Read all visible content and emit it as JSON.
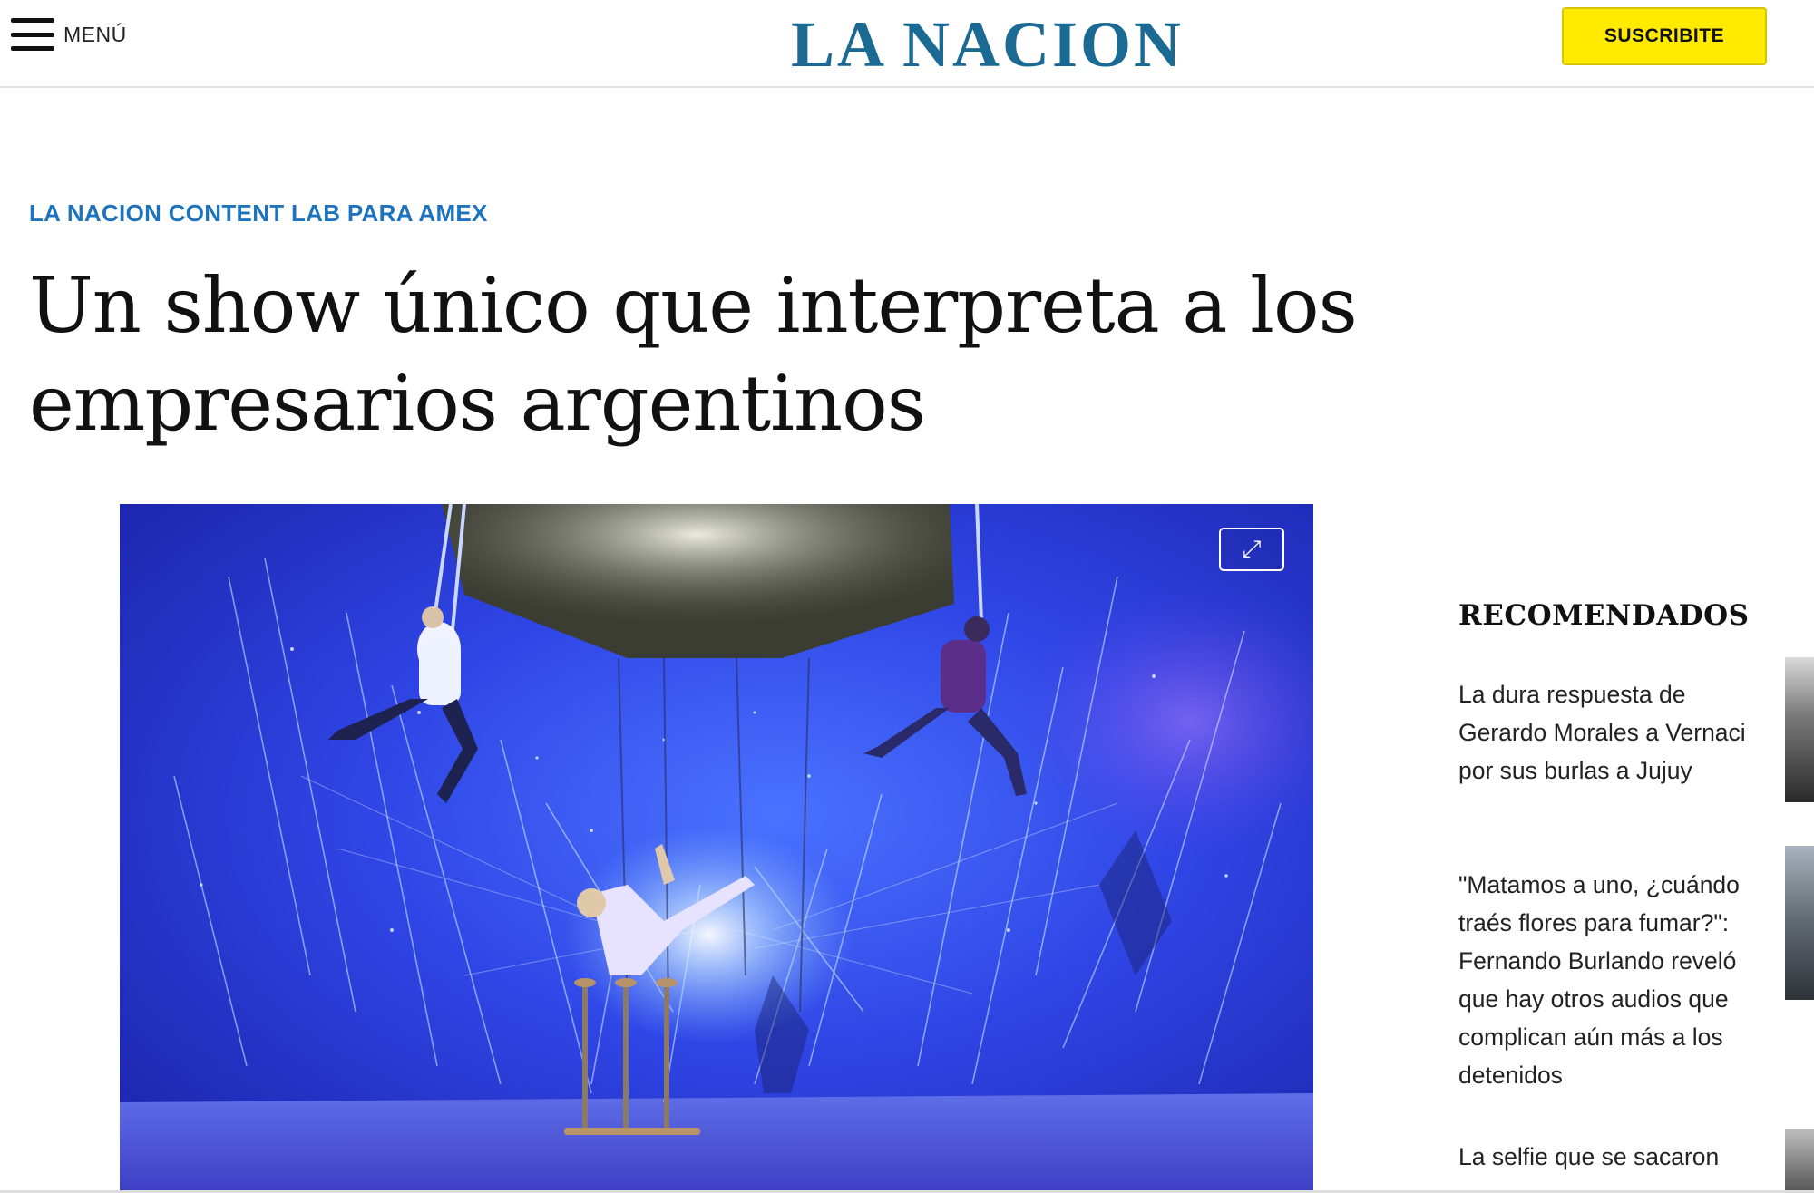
{
  "header": {
    "menu_label": "MENÚ",
    "logo_text": "LA NACION",
    "subscribe_label": "SUSCRIBITE"
  },
  "article": {
    "kicker": "LA NACION CONTENT LAB PARA AMEX",
    "headline": "Un show único que interpreta a los empresarios argentinos"
  },
  "hero": {
    "expand_icon": "expand-icon",
    "expand_glyph": "⤢"
  },
  "sidebar": {
    "title": "RECOMENDADOS",
    "items": [
      {
        "text": "La dura respuesta de Gerardo Morales a Vernaci por sus burlas a Jujuy"
      },
      {
        "text": "\"Matamos a uno, ¿cuándo traés flores para fumar?\": Fernando Burlando reveló que hay otros audios que complican aún más a los detenidos"
      },
      {
        "text": "La selfie que se sacaron"
      }
    ]
  },
  "colors": {
    "logo": "#1a6a94",
    "kicker": "#1e73be",
    "subscribe_bg": "#ffea00",
    "hero_blue": "#2a3bd8"
  }
}
